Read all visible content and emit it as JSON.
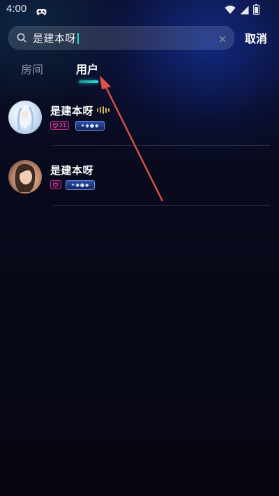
{
  "status_bar": {
    "time": "4:00",
    "icons": [
      "gamepad-icon",
      "wifi-icon",
      "signal-icon",
      "battery-icon"
    ]
  },
  "search": {
    "value": "是建本呀",
    "clear_icon": "clear-icon",
    "cancel_label": "取消"
  },
  "tabs": [
    {
      "label": "房间",
      "active": false
    },
    {
      "label": "用户",
      "active": true
    }
  ],
  "users": [
    {
      "name": "是建本呀",
      "speaking": true,
      "level": "21",
      "medal_icon": "medal-badge-icon"
    },
    {
      "name": "是建本呀",
      "speaking": false,
      "level": "",
      "medal_icon": "medal-badge-icon"
    }
  ],
  "colors": {
    "accent": "#35e0d2",
    "level_badge": "#c72b8f",
    "annotation_arrow": "#e0504a",
    "voice_indicator": "#d9b24a"
  }
}
